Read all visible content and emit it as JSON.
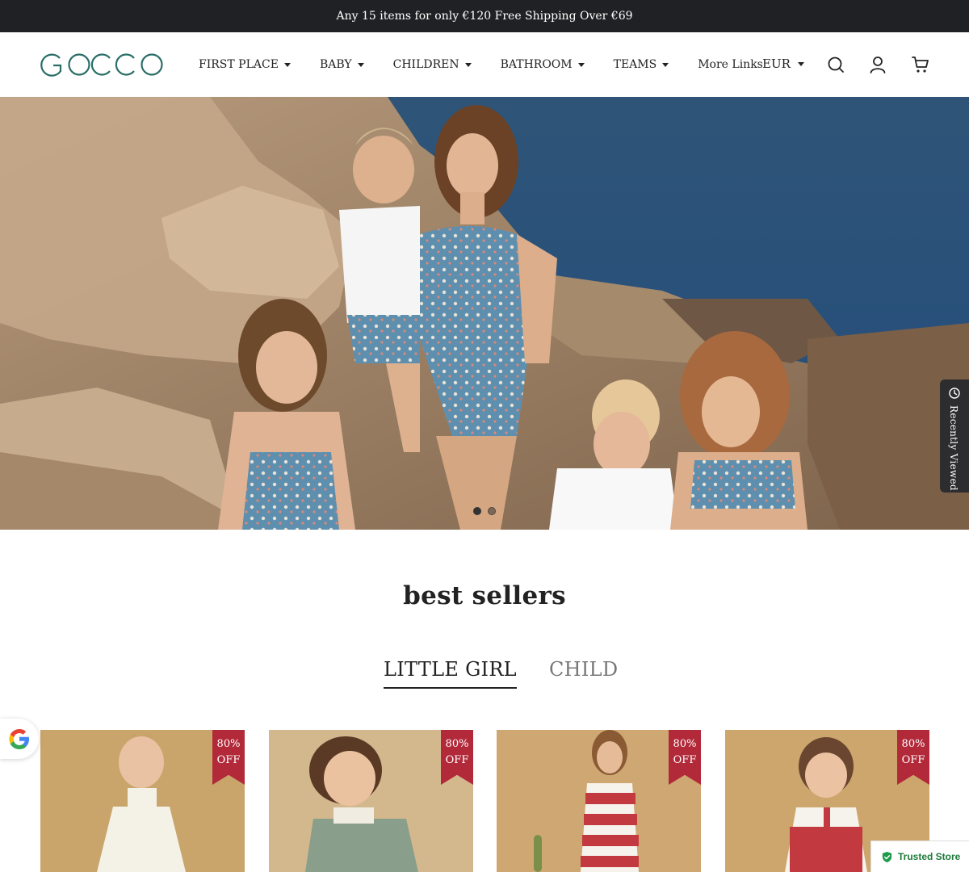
{
  "announcement": "Any 15 items for only €120 Free Shipping Over €69",
  "brand": {
    "name": "GOCCO",
    "color": "#2a6e68"
  },
  "nav": {
    "items": [
      {
        "label": "FIRST PLACE",
        "dropdown": true
      },
      {
        "label": "BABY",
        "dropdown": true
      },
      {
        "label": "CHILDREN",
        "dropdown": true
      },
      {
        "label": "BATHROOM",
        "dropdown": true
      },
      {
        "label": "TEAMS",
        "dropdown": true
      },
      {
        "label": "More Links",
        "dropdown": false
      }
    ],
    "currency": "EUR",
    "icons": [
      "search-icon",
      "account-icon",
      "cart-icon"
    ]
  },
  "hero": {
    "slides_total": 2,
    "active_slide": 1
  },
  "recently_viewed": {
    "label": "Recently Viewed",
    "icon": "clock-icon"
  },
  "best_sellers": {
    "title": "best sellers",
    "tabs": [
      {
        "label": "LITTLE GIRL",
        "active": true
      },
      {
        "label": "CHILD",
        "active": false
      }
    ],
    "products": [
      {
        "badge_line1": "80%",
        "badge_line2": "OFF",
        "dress_color": "#f4f1e6"
      },
      {
        "badge_line1": "80%",
        "badge_line2": "OFF",
        "dress_color": "#8a9e8c"
      },
      {
        "badge_line1": "80%",
        "badge_line2": "OFF",
        "dress_color": "#c23a3f"
      },
      {
        "badge_line1": "80%",
        "badge_line2": "OFF",
        "dress_color": "#c23a3f"
      }
    ]
  },
  "trusted_store": {
    "label": "Trusted Store"
  },
  "colors": {
    "announcement_bg": "#202124",
    "badge": "#b22a3a",
    "recent_bg": "#2d2d2f",
    "trusted_green": "#1d7a3a"
  }
}
